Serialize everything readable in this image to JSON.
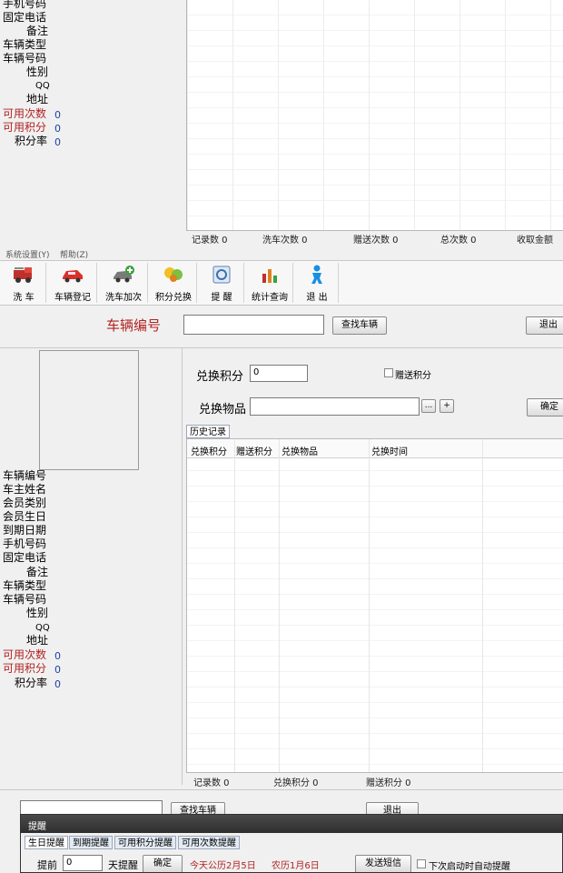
{
  "top_panel": {
    "labels": [
      "手机号码",
      "固定电话",
      "备注",
      "车辆类型",
      "车辆号码",
      "性别",
      "QQ",
      "地址",
      "可用次数",
      "可用积分",
      "积分率"
    ],
    "values": {
      "available_count": "0",
      "available_points": "0",
      "points_rate": "0"
    },
    "status": {
      "records": "记录数 0",
      "wash_count": "洗车次数 0",
      "gift_count": "赠送次数 0",
      "total_count": "总次数 0",
      "amount": "收取金额"
    }
  },
  "menu": {
    "settings": "系统设置(Y)",
    "help": "帮助(Z)"
  },
  "toolbar": [
    {
      "label": "洗 车",
      "icon": "fire-truck-icon"
    },
    {
      "label": "车辆登记",
      "icon": "red-car-icon"
    },
    {
      "label": "洗车加次",
      "icon": "car-plus-icon"
    },
    {
      "label": "积分兑换",
      "icon": "points-coins-icon"
    },
    {
      "label": "提 醒",
      "icon": "reminder-icon"
    },
    {
      "label": "统计查询",
      "icon": "statistics-icon"
    },
    {
      "label": "退 出",
      "icon": "exit-person-icon"
    }
  ],
  "search": {
    "label": "车辆编号",
    "value": "",
    "find_button": "查找车辆",
    "exit_button": "退出"
  },
  "exchange": {
    "points_label": "兑换积分",
    "points_value": "0",
    "gift_points_label": "赠送积分",
    "item_label": "兑换物品",
    "item_value": "",
    "browse_button": "...",
    "add_button": "+",
    "confirm_button": "确定",
    "history_tab": "历史记录",
    "columns": [
      "兑换积分",
      "赠送积分",
      "兑换物品",
      "兑换时间"
    ],
    "status": {
      "records": "记录数 0",
      "points": "兑换积分 0",
      "gift": "赠送积分 0"
    }
  },
  "bottom_labels": {
    "labels": [
      "车辆编号",
      "车主姓名",
      "会员类别",
      "会员生日",
      "到期日期",
      "手机号码",
      "固定电话",
      "备注",
      "车辆类型",
      "车辆号码",
      "性别",
      "QQ",
      "地址",
      "可用次数",
      "可用积分",
      "积分率"
    ],
    "values": {
      "available_count": "0",
      "available_points": "0",
      "points_rate": "0"
    }
  },
  "background_buttons": {
    "find": "查找车辆",
    "exit": "退出"
  },
  "reminder_window": {
    "title": "提醒",
    "tabs": [
      "生日提醒",
      "到期提醒",
      "可用积分提醒",
      "可用次数提醒"
    ],
    "advance_label": "提前",
    "advance_value": "0",
    "days_label": "天提醒",
    "confirm_button": "确定",
    "today_text": "今天公历2月5日",
    "lunar_text": "农历1月6日",
    "sms_button": "发送短信",
    "auto_remind_label": "下次启动时自动提醒"
  },
  "colors": {
    "accent_red": "#b22222",
    "value_blue": "#1f3fa8",
    "titlebar": "#3a3a3a"
  }
}
